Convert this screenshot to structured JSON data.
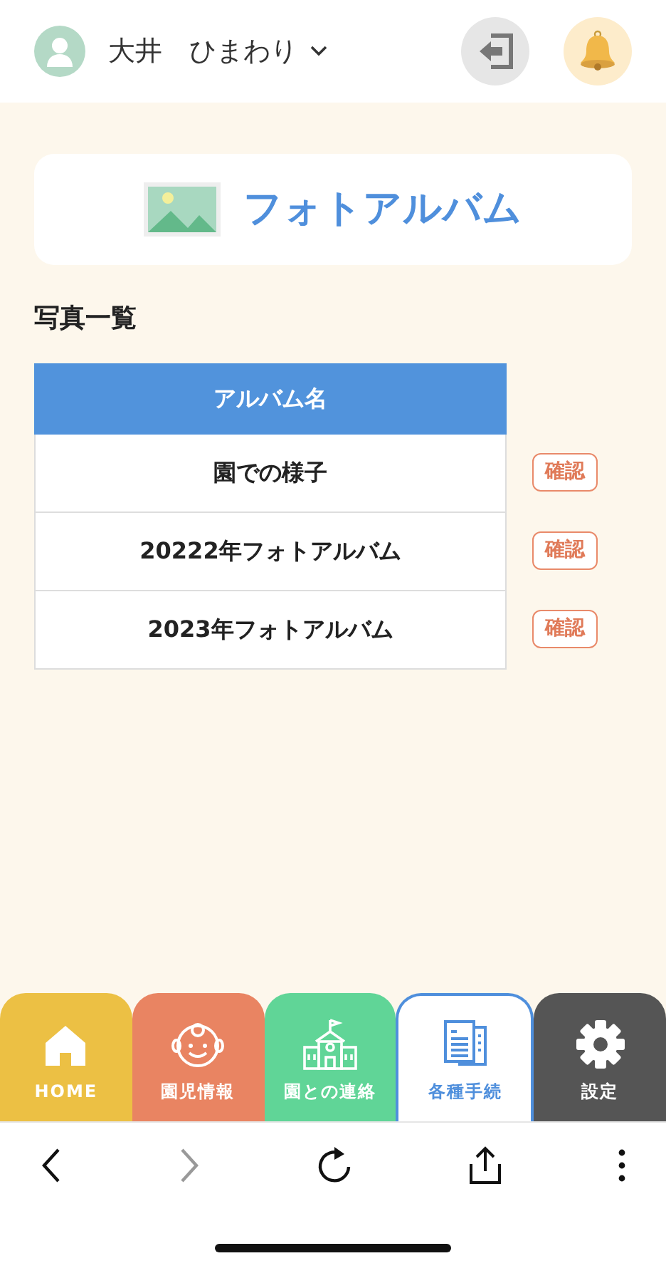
{
  "user": {
    "name": "大井　ひまわり"
  },
  "page_title": "フォトアルバム",
  "section_title": "写真一覧",
  "table": {
    "columns": [
      "アルバム名"
    ],
    "rows": [
      {
        "album_name": "園での様子",
        "action": "確認"
      },
      {
        "album_name": "20222年フォトアルバム",
        "action": "確認"
      },
      {
        "album_name": "2023年フォトアルバム",
        "action": "確認"
      }
    ]
  },
  "tabs": [
    {
      "label": "HOME",
      "kind": "home",
      "color": "#ecc044",
      "selected": false
    },
    {
      "label": "園児情報",
      "kind": "child",
      "color": "#e98462",
      "selected": false
    },
    {
      "label": "園との連絡",
      "kind": "school",
      "color": "#60d597",
      "selected": false
    },
    {
      "label": "各種手続",
      "kind": "docs",
      "color": "#4f8fdc",
      "selected": true
    },
    {
      "label": "設定",
      "kind": "settings",
      "color": "#555555",
      "selected": false
    }
  ],
  "browser_bar": {
    "back_disabled": false,
    "forward_disabled": true
  }
}
